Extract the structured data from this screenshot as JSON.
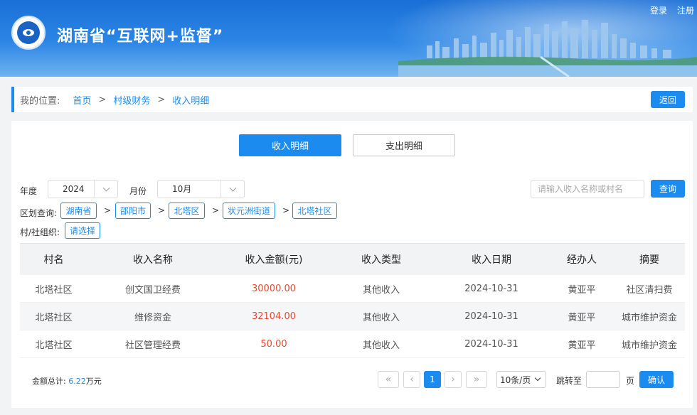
{
  "header": {
    "site_title": "湖南省“互联网+监督”",
    "login": "登录",
    "register": "注册"
  },
  "breadcrumb": {
    "label": "我的位置:",
    "items": [
      "首页",
      "村级财务",
      "收入明细"
    ],
    "separator": ">",
    "back": "返回"
  },
  "tabs": [
    {
      "label": "收入明细",
      "active": true
    },
    {
      "label": "支出明细",
      "active": false
    }
  ],
  "filters": {
    "year_label": "年度",
    "year_value": "2024",
    "month_label": "月份",
    "month_value": "10月",
    "search_placeholder": "请输入收入名称或村名",
    "search_button": "查询",
    "region_label": "区划查询:",
    "region_path": [
      "湖南省",
      "邵阳市",
      "北塔区",
      "状元洲街道",
      "北塔社区"
    ],
    "org_label": "村/社组织:",
    "org_button": "请选择"
  },
  "table": {
    "columns": [
      "村名",
      "收入名称",
      "收入金额(元)",
      "收入类型",
      "收入日期",
      "经办人",
      "摘要"
    ],
    "rows": [
      [
        "北塔社区",
        "创文国卫经费",
        "30000.00",
        "其他收入",
        "2024-10-31",
        "黄亚平",
        "社区清扫费"
      ],
      [
        "北塔社区",
        "维修资金",
        "32104.00",
        "其他收入",
        "2024-10-31",
        "黄亚平",
        "城市维护资金"
      ],
      [
        "北塔社区",
        "社区管理经费",
        "50.00",
        "其他收入",
        "2024-10-31",
        "黄亚平",
        "城市维护资金"
      ]
    ]
  },
  "footer": {
    "total_label": "金额总计:",
    "total_value": "6.22",
    "total_unit": "万元",
    "current_page": "1",
    "page_size": "10条/页",
    "jump_label": "跳转至",
    "page_unit": "页",
    "confirm": "确认"
  },
  "colors": {
    "accent": "#1b8bf0",
    "amount": "#e6492d"
  }
}
